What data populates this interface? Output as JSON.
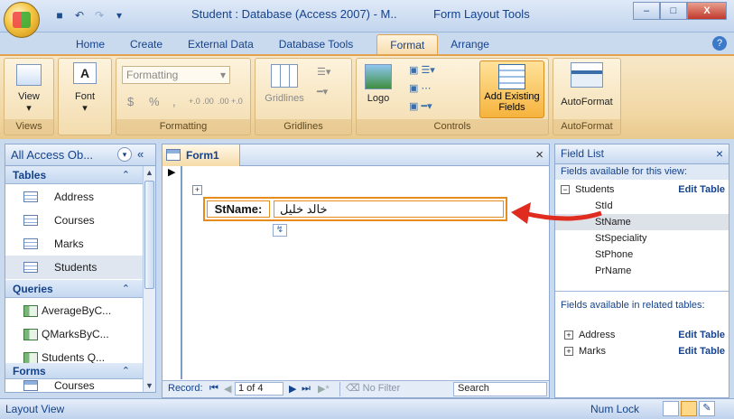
{
  "window": {
    "title": "Student : Database (Access 2007) - M..",
    "context_tab": "Form Layout Tools",
    "minimize": "–",
    "maximize": "□",
    "close": "X"
  },
  "tabs": [
    "Home",
    "Create",
    "External Data",
    "Database Tools",
    "Format",
    "Arrange"
  ],
  "ribbon": {
    "views": {
      "label": "View",
      "caption": "Views"
    },
    "font": {
      "label": "Font",
      "caption": ""
    },
    "formatting": {
      "dropdown": "Formatting",
      "currency": "$",
      "percent": "%",
      "comma": ",",
      "inc": "+.0 .00",
      "dec": ".00 +.0",
      "caption": "Formatting"
    },
    "gridlines": {
      "label": "Gridlines",
      "caption": "Gridlines"
    },
    "controls": {
      "logo": "Logo",
      "caption": "Controls"
    },
    "add_fields": {
      "label": "Add Existing Fields"
    },
    "autoformat": {
      "label": "AutoFormat",
      "caption": "AutoFormat"
    }
  },
  "nav": {
    "header": "All Access Ob...",
    "sections": [
      {
        "name": "Tables",
        "items": [
          "Address",
          "Courses",
          "Marks",
          "Students"
        ]
      },
      {
        "name": "Queries",
        "items": [
          "AverageByC...",
          "QMarksByC...",
          "Students Q..."
        ]
      },
      {
        "name": "Forms",
        "items": [
          "Courses"
        ]
      }
    ]
  },
  "doc": {
    "tab": "Form1",
    "label": "StName:",
    "value": "خالد خليل",
    "close": "×"
  },
  "record_nav": {
    "label": "Record:",
    "pos": "1 of 4",
    "filter": "No Filter",
    "search": "Search"
  },
  "field_list": {
    "title": "Field List",
    "section1": "Fields available for this view:",
    "table": "Students",
    "edit": "Edit Table",
    "fields": [
      "StId",
      "StName",
      "StSpeciality",
      "StPhone",
      "PrName"
    ],
    "section2": "Fields available in related tables:",
    "related": [
      "Address",
      "Marks"
    ]
  },
  "status": {
    "left": "Layout View",
    "numlock": "Num Lock"
  },
  "colors": {
    "accent": "#e88b1d",
    "arrow": "#e02b1f"
  }
}
